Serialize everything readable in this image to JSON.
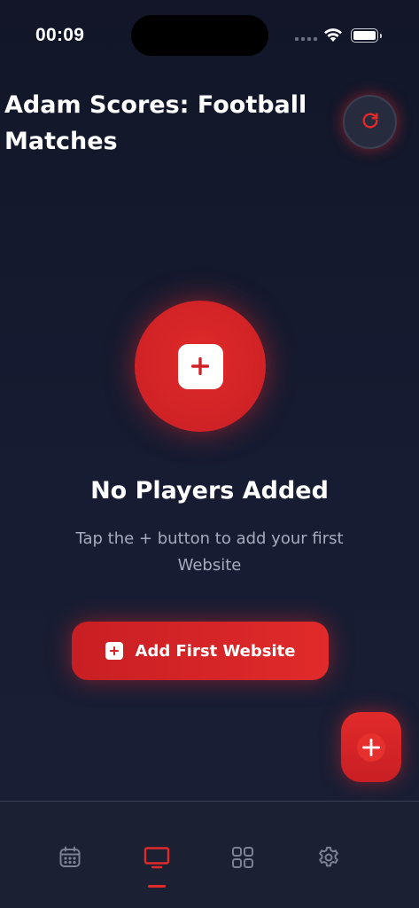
{
  "status_bar": {
    "time": "00:09",
    "signal_icon": "cellular-signal-icon",
    "wifi_icon": "wifi-icon",
    "battery_icon": "battery-icon"
  },
  "header": {
    "title": "Adam Scores: Football Matches",
    "refresh_icon": "refresh-icon"
  },
  "empty_state": {
    "icon": "plus-square-icon",
    "title": "No Players Added",
    "subtitle": "Tap the + button to add your first Website",
    "button_label": "Add First Website",
    "button_icon": "plus-square-icon"
  },
  "fab": {
    "icon": "plus-icon"
  },
  "tab_bar": {
    "tabs": [
      {
        "icon": "calendar-icon",
        "active": false
      },
      {
        "icon": "tv-icon",
        "active": true
      },
      {
        "icon": "grid-icon",
        "active": false
      },
      {
        "icon": "gear-icon",
        "active": false
      }
    ]
  },
  "colors": {
    "accent": "#e12a2a",
    "background": "#161b31",
    "tab_bar": "#1c2033",
    "inactive_icon": "#7d8194",
    "subtitle_text": "#a8abbd"
  }
}
